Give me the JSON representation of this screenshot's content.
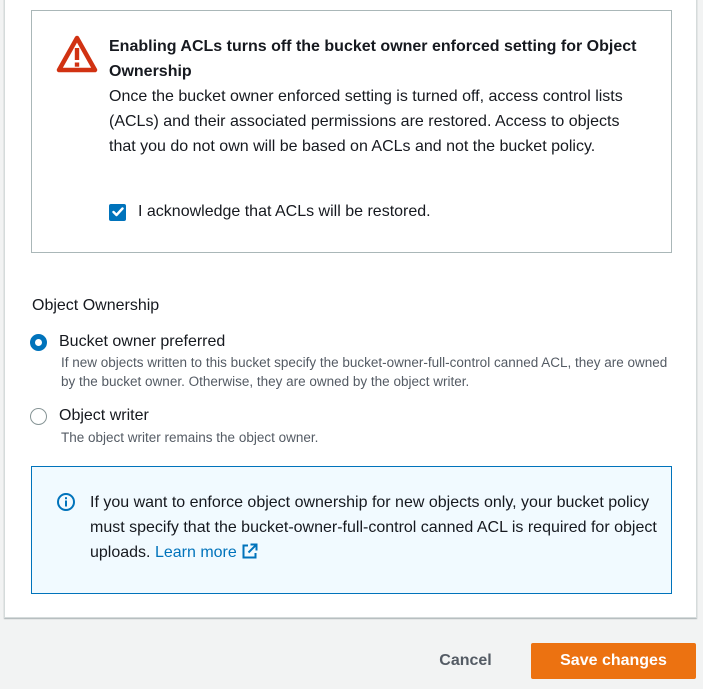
{
  "warning": {
    "title": "Enabling ACLs turns off the bucket owner enforced setting for Object Ownership",
    "body": "Once the bucket owner enforced setting is turned off, access control lists (ACLs) and their associated permissions are restored. Access to objects that you do not own will be based on ACLs and not the bucket policy.",
    "ack_label": "I acknowledge that ACLs will be restored.",
    "ack_checked": true,
    "icon": "warning-triangle-icon",
    "icon_color": "#d13212"
  },
  "ownership": {
    "title": "Object Ownership",
    "options": [
      {
        "label": "Bucket owner preferred",
        "description": "If new objects written to this bucket specify the bucket-owner-full-control canned ACL, they are owned by the bucket owner. Otherwise, they are owned by the object writer.",
        "selected": true
      },
      {
        "label": "Object writer",
        "description": "The object writer remains the object owner.",
        "selected": false
      }
    ]
  },
  "info": {
    "text": "If you want to enforce object ownership for new objects only, your bucket policy must specify that the bucket-owner-full-control canned ACL is required for object uploads.",
    "link": "Learn more",
    "icon": "info-circle-icon",
    "link_icon": "external-link-icon"
  },
  "footer": {
    "cancel_label": "Cancel",
    "save_label": "Save changes"
  },
  "colors": {
    "accent": "#0073bb",
    "primary_button": "#ec7211",
    "warning": "#d13212"
  }
}
